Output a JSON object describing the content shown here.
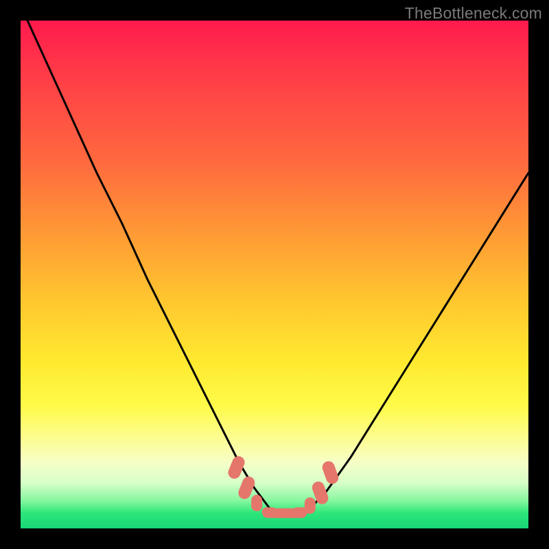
{
  "watermark": {
    "text": "TheBottleneck.com"
  },
  "colors": {
    "background": "#000000",
    "curve": "#000000",
    "marker_fill": "#e5766b",
    "marker_stroke": "#e5766b",
    "gradient_stops": [
      "#ff1a4d",
      "#ff6a3e",
      "#ffe92f",
      "#2de57a"
    ]
  },
  "chart_data": {
    "type": "line",
    "title": "",
    "xlabel": "",
    "ylabel": "",
    "xlim": [
      0,
      100
    ],
    "ylim": [
      0,
      100
    ],
    "grid": false,
    "legend": false,
    "series": [
      {
        "name": "bottleneck-curve",
        "x": [
          0,
          5,
          10,
          15,
          20,
          25,
          30,
          35,
          40,
          43,
          46,
          49,
          51,
          53,
          55,
          57,
          60,
          65,
          70,
          75,
          80,
          85,
          90,
          95,
          100
        ],
        "y": [
          103,
          92,
          81,
          70,
          60,
          49,
          39,
          29,
          19,
          13,
          8,
          4,
          3,
          3,
          3,
          4,
          7,
          14,
          22,
          30,
          38,
          46,
          54,
          62,
          70
        ]
      }
    ],
    "markers": {
      "name": "valley-markers",
      "shape": "rounded-rect",
      "color": "#e5766b",
      "points": [
        {
          "x": 42.5,
          "y": 12
        },
        {
          "x": 44.5,
          "y": 8
        },
        {
          "x": 46.5,
          "y": 5
        },
        {
          "x": 49,
          "y": 3.2
        },
        {
          "x": 51,
          "y": 3.0
        },
        {
          "x": 53,
          "y": 3.0
        },
        {
          "x": 55,
          "y": 3.2
        },
        {
          "x": 57,
          "y": 4.5
        },
        {
          "x": 59,
          "y": 7
        },
        {
          "x": 61,
          "y": 11
        }
      ]
    }
  }
}
